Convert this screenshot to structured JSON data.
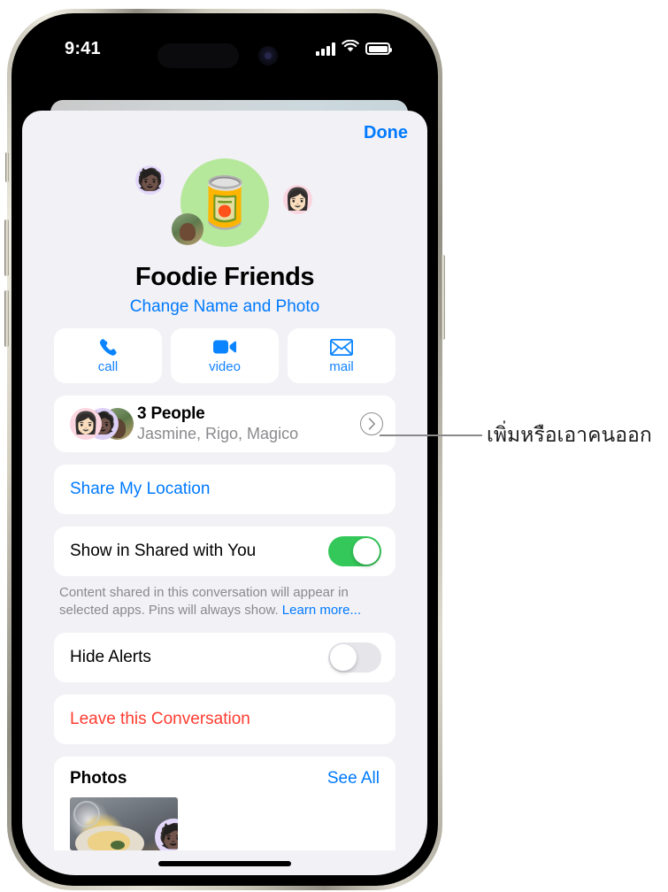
{
  "status_bar": {
    "time": "9:41",
    "cellular_icon": "signal-bars-icon",
    "wifi_icon": "wifi-icon",
    "battery_icon": "battery-icon"
  },
  "sheet": {
    "done_label": "Done"
  },
  "group": {
    "title": "Foodie Friends",
    "change_link": "Change Name and Photo",
    "main_avatar_emoji": "🥫",
    "main_avatar_color": "#b6e89b",
    "mini_avatars": [
      {
        "name": "memoji-dark-hair-glasses",
        "emoji": "🧑🏿",
        "bg": "#e3d7fa"
      },
      {
        "name": "memoji-pink-glasses",
        "emoji": "👩🏻",
        "bg": "#fbd6e0"
      },
      {
        "name": "photo-avatar-outdoor",
        "emoji": "",
        "bg": "#6d8a5a"
      }
    ]
  },
  "actions": [
    {
      "label": "call",
      "icon": "phone-icon"
    },
    {
      "label": "video",
      "icon": "video-camera-icon"
    },
    {
      "label": "mail",
      "icon": "envelope-icon"
    }
  ],
  "people": {
    "title": "3 People",
    "subtitle": "Jasmine, Rigo, Magico",
    "chevron_icon": "chevron-right-icon"
  },
  "share_location": {
    "label": "Share My Location"
  },
  "shared_with_you": {
    "label": "Show in Shared with You",
    "toggle_state": "on",
    "footnote_text": "Content shared in this conversation will appear in selected apps. Pins will always show. ",
    "footnote_link": "Learn more..."
  },
  "hide_alerts": {
    "label": "Hide Alerts",
    "toggle_state": "off"
  },
  "leave": {
    "label": "Leave this Conversation"
  },
  "photos": {
    "title": "Photos",
    "see_all": "See All",
    "reaction_emoji": "🧑🏿"
  },
  "callout": {
    "text": "เพิ่มหรือเอาคนออก"
  },
  "colors": {
    "accent_blue": "#007aff",
    "destructive_red": "#ff3b30",
    "toggle_on_green": "#34c759",
    "sheet_bg": "#f2f1f6",
    "card_bg": "#ffffff",
    "secondary_text": "#8a8a8e"
  }
}
